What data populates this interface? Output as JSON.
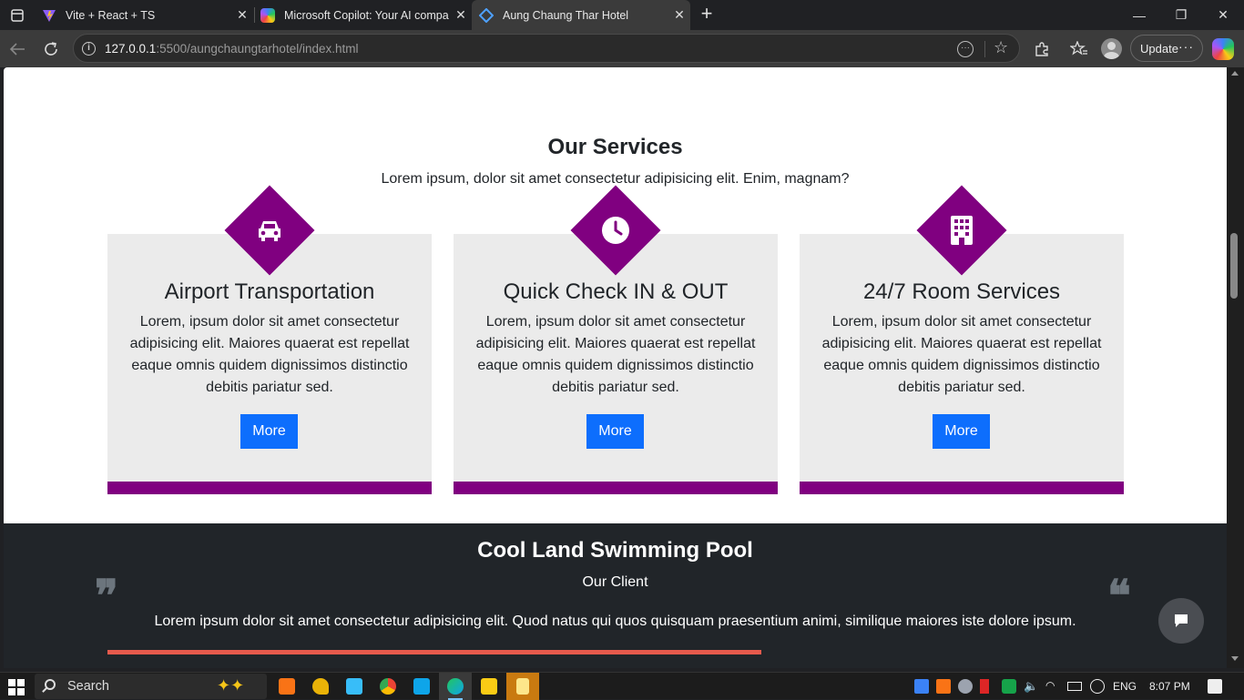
{
  "browser": {
    "tabs": [
      {
        "title": "Vite + React + TS",
        "active": false
      },
      {
        "title": "Microsoft Copilot: Your AI compa",
        "active": false
      },
      {
        "title": "Aung Chaung Thar Hotel",
        "active": true
      }
    ],
    "url_host": "127.0.0.1",
    "url_path": ":5500/aungchaungtarhotel/index.html",
    "update_label": "Update",
    "more_dots": "···"
  },
  "services": {
    "title": "Our Services",
    "subtitle": "Lorem ipsum, dolor sit amet consectetur adipisicing elit. Enim, magnam?",
    "cards": [
      {
        "icon": "car-icon",
        "title": "Airport Transportation",
        "text": "Lorem, ipsum dolor sit amet consectetur adipisicing elit. Maiores quaerat est repellat eaque omnis quidem dignissimos distinctio debitis pariatur sed.",
        "button": "More"
      },
      {
        "icon": "clock-icon",
        "title": "Quick Check IN & OUT",
        "text": "Lorem, ipsum dolor sit amet consectetur adipisicing elit. Maiores quaerat est repellat eaque omnis quidem dignissimos distinctio debitis pariatur sed.",
        "button": "More"
      },
      {
        "icon": "building-icon",
        "title": "24/7 Room Services",
        "text": "Lorem, ipsum dolor sit amet consectetur adipisicing elit. Maiores quaerat est repellat eaque omnis quidem dignissimos distinctio debitis pariatur sed.",
        "button": "More"
      }
    ]
  },
  "pool": {
    "title": "Cool Land Swimming Pool",
    "subtitle": "Our Client",
    "text": "Lorem ipsum dolor sit amet consectetur adipisicing elit. Quod natus qui quos quisquam praesentium animi, similique maiores iste dolore ipsum.",
    "quote_left": "❞",
    "quote_right": "❝"
  },
  "taskbar": {
    "search_label": "Search",
    "lang": "ENG",
    "time": "8:07 PM"
  },
  "colors": {
    "accent_purple": "#800080",
    "button_blue": "#0d6efd",
    "dark_section": "#212529",
    "red_line": "#e65a4c"
  }
}
